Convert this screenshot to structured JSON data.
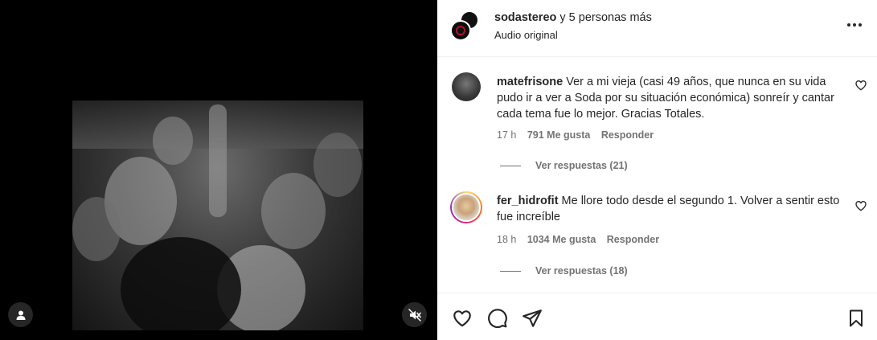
{
  "post": {
    "author": "sodastereo",
    "coauthors_text": "y 5 personas más",
    "audio_label": "Audio original"
  },
  "comments": [
    {
      "username": "matefrisone",
      "text": "Ver a mi vieja (casi 49 años, que nunca en su vida pudo ir a ver a Soda por su situación económica) sonreír y cantar cada tema fue lo mejor. Gracias Totales.",
      "time": "17 h",
      "likes": "791 Me gusta",
      "reply_label": "Responder",
      "view_replies": "Ver respuestas (21)"
    },
    {
      "username": "fer_hidrofit",
      "text": "Me llore todo desde el segundo 1. Volver a sentir esto fue increíble",
      "time": "18 h",
      "likes": "1034 Me gusta",
      "reply_label": "Responder",
      "view_replies": "Ver respuestas (18)"
    }
  ],
  "icons": {
    "more": "more-options-icon",
    "like": "heart-icon",
    "comment": "comment-icon",
    "share": "share-icon",
    "save": "bookmark-icon",
    "muted": "volume-muted-icon",
    "tags": "user-tag-icon"
  },
  "colors": {
    "text": "#262626",
    "secondary": "#737373",
    "divider": "#efefef",
    "video_bg": "#000000"
  }
}
